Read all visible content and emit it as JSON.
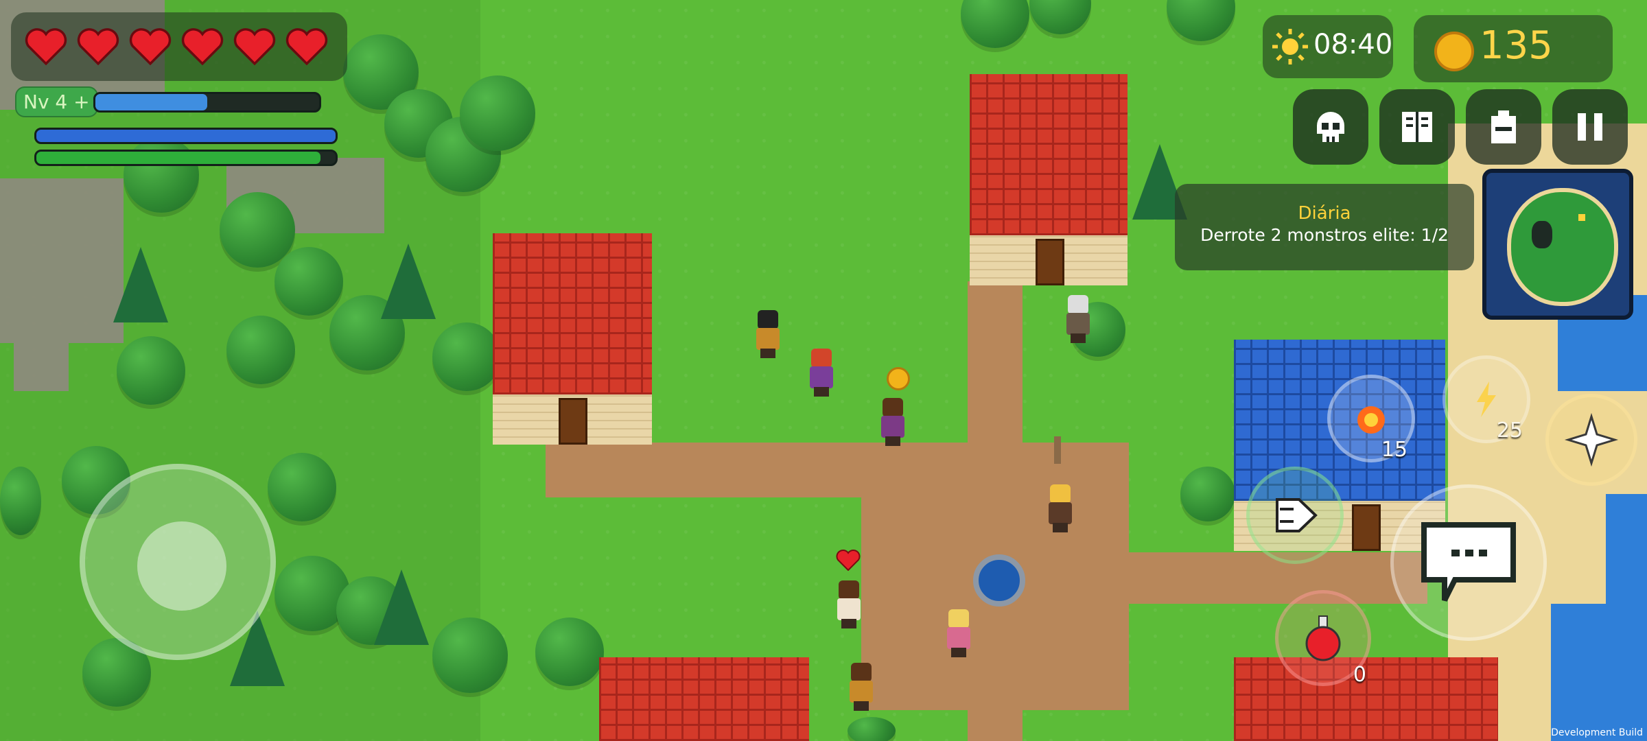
{
  "hud": {
    "hearts": 6,
    "level_label": "Nv 4 +",
    "xp_progress": 0.5,
    "health_bar_progress": 1.0,
    "stamina_bar_progress": 0.95,
    "time": "08:40",
    "coins": "135",
    "potion_count": "0",
    "fire_skill_count": "15",
    "lightning_skill_count": "25"
  },
  "quest": {
    "title": "Diária",
    "text": "Derrote 2 monstros elite: 1/2"
  },
  "menu_icons": [
    "skull-icon",
    "journal-icon",
    "backpack-icon",
    "pause-icon"
  ],
  "footer": {
    "dev_build": "Development Build"
  },
  "colors": {
    "grass": "#5cbc38",
    "red_roof": "#d43a2a",
    "blue_roof": "#2f6ad2",
    "heart": "#e8202a",
    "coin": "#ffd54a"
  }
}
